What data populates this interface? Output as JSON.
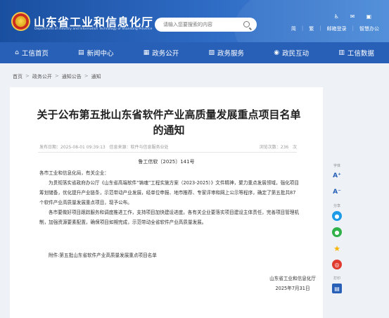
{
  "header": {
    "title": "山东省工业和信息化厅",
    "subtitle": "Department of Industry and Information Technology of Shandong Province",
    "search_placeholder": "请输入您要搜索的内容",
    "tools": [
      "简",
      "繁",
      "邮箱登录",
      "智慧办公"
    ]
  },
  "nav": {
    "items": [
      {
        "label": "工信首页",
        "icon": "home-icon"
      },
      {
        "label": "新闻中心",
        "icon": "news-icon"
      },
      {
        "label": "政务公开",
        "icon": "gov-icon"
      },
      {
        "label": "政务服务",
        "icon": "service-icon"
      },
      {
        "label": "政民互动",
        "icon": "interact-icon"
      },
      {
        "label": "工信数据",
        "icon": "data-icon"
      }
    ]
  },
  "breadcrumb": [
    "首页",
    "政务公开",
    "通知公告",
    "通知"
  ],
  "article": {
    "title": "关于公布第五批山东省软件产业高质量发展重点项目名单的通知",
    "publish": "发布日期：2025-08-01 09:39:13",
    "source": "信息来源：软件与信息服务业处",
    "views_label": "浏览次数：",
    "views": "236",
    "views_unit": "次",
    "doc_no": "鲁工信软〔2025〕141号",
    "salutation": "各市工业和信息化局，有关企业：",
    "para1": "为贯彻落实省政府办公厅《山东省高端软件“铸魂”工程实施方案（2023-2025）》文件精神，聚力重点发展领域，强化项目筹划储备，优化提升产业链条，示范带动产业发展，经单位申报、地市推荐、专家评审和网上公示等程序，确定了第五批共87个软件产业高质量发展重点项目，现予公布。",
    "para2": "各市要做好项目跟踪服务和调度推进工作，支持项目加快建设进度。各有关企业要落实项目建设主体责任，完善项目管理机制，加强资源要素配置，确保项目如期完成，示范带动全省软件产业高质量发展。",
    "attachment": "附件:第五批山东省软件产业高质量发展重点项目名单",
    "signer": "山东省工业和信息化厅",
    "sign_date": "2025年7月31日"
  },
  "side": {
    "font_label": "字体",
    "font_up": "A⁺",
    "font_down": "A⁻",
    "share_label": "分享",
    "print_label": "打印",
    "colors": {
      "qq": "#1e9be8",
      "wechat": "#2fb24a",
      "star": "#f5b400",
      "weibo": "#e03a2f",
      "print": "#2860b8"
    }
  }
}
